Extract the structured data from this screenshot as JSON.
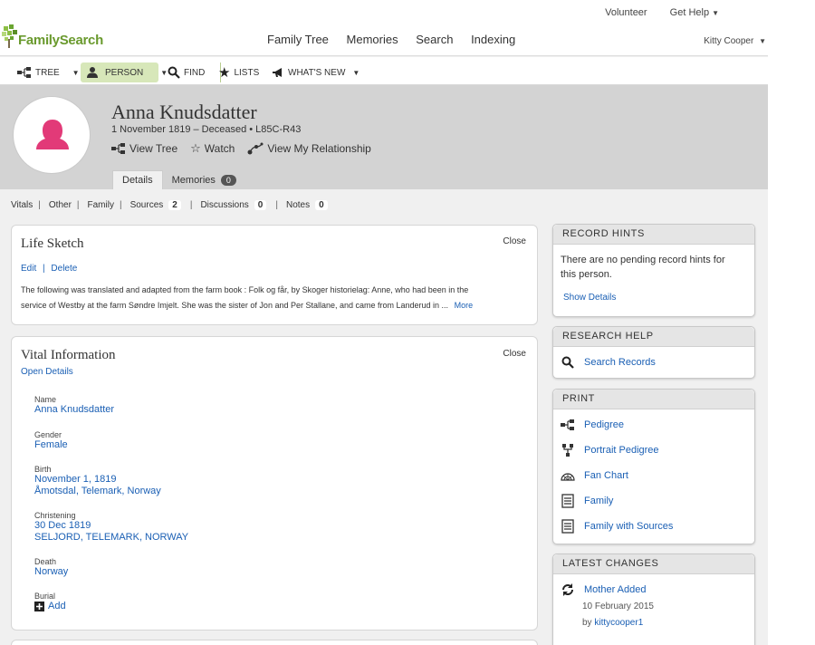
{
  "util": {
    "volunteer": "Volunteer",
    "get_help": "Get Help",
    "user": "Kitty Cooper"
  },
  "brand": {
    "name": "FamilySearch"
  },
  "mainnav": [
    "Family Tree",
    "Memories",
    "Search",
    "Indexing"
  ],
  "toolbar": {
    "tree": "TREE",
    "person": "PERSON",
    "find": "FIND",
    "lists": "LISTS",
    "whats_new": "WHAT'S NEW"
  },
  "person": {
    "name": "Anna Knudsdatter",
    "summary": "1 November 1819 – Deceased • L85C-R43",
    "view_tree": "View Tree",
    "watch": "Watch",
    "view_relationship": "View My Relationship",
    "tabs": {
      "details": "Details",
      "memories": "Memories",
      "memories_count": "0"
    }
  },
  "subnav": {
    "vitals": "Vitals",
    "other": "Other",
    "family": "Family",
    "sources": "Sources",
    "sources_count": "2",
    "discussions": "Discussions",
    "discussions_count": "0",
    "notes": "Notes",
    "notes_count": "0"
  },
  "life_sketch": {
    "title": "Life Sketch",
    "close": "Close",
    "edit": "Edit",
    "delete": "Delete",
    "text_1": "The following was translated and adapted from the farm book : Folk og får, by Skoger historielag: Anne, who had been in the",
    "text_2": "service of Westby at the farm Søndre Imjelt. She was the sister of Jon and Per Stallane, and came from Landerud in ...",
    "more": "More"
  },
  "vital": {
    "title": "Vital Information",
    "close": "Close",
    "open_details": "Open Details",
    "name_label": "Name",
    "name_value": "Anna Knudsdatter",
    "gender_label": "Gender",
    "gender_value": "Female",
    "birth_label": "Birth",
    "birth_date": "November 1, 1819",
    "birth_place": "Åmotsdal, Telemark, Norway",
    "christening_label": "Christening",
    "christening_date": "30 Dec 1819",
    "christening_place": "SELJORD, TELEMARK, NORWAY",
    "death_label": "Death",
    "death_place": "Norway",
    "burial_label": "Burial",
    "burial_add": "Add"
  },
  "record_hints": {
    "title": "RECORD HINTS",
    "text": "There are no pending record hints for this person.",
    "show_details": "Show Details"
  },
  "research_help": {
    "title": "RESEARCH HELP",
    "search_records": "Search Records"
  },
  "print": {
    "title": "PRINT",
    "items": [
      "Pedigree",
      "Portrait Pedigree",
      "Fan Chart",
      "Family",
      "Family with Sources"
    ]
  },
  "latest_changes": {
    "title": "LATEST CHANGES",
    "change": "Mother Added",
    "date": "10 February 2015",
    "by_prefix": "by",
    "by_user": "kittycooper1"
  }
}
